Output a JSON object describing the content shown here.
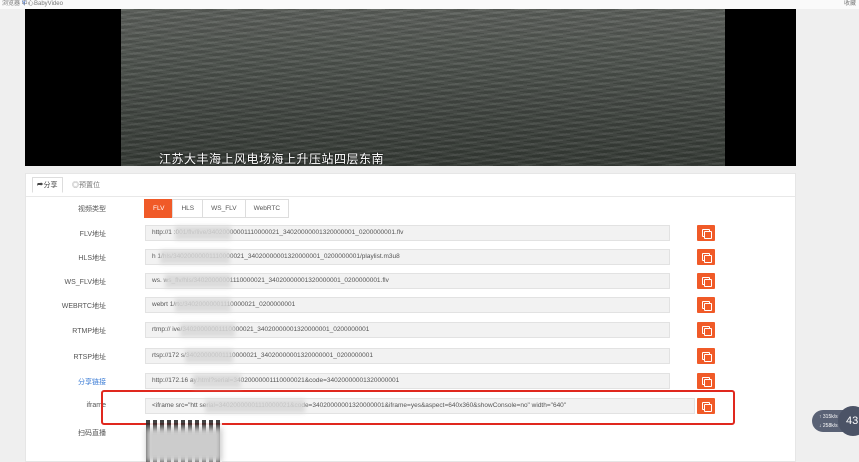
{
  "topbar": {
    "left1": "浏览器 中心",
    "left2": "Y",
    "left3": "BabyVideo",
    "right": "收藏"
  },
  "video": {
    "caption": "江苏大丰海上风电场海上升压站四层东南"
  },
  "tabs": [
    {
      "label": "⮫分享"
    },
    {
      "label": "◎预置位"
    }
  ],
  "form": {
    "video_type_label": "视频类型",
    "types": [
      "FLV",
      "HLS",
      "WS_FLV",
      "WebRTC"
    ],
    "selected_type": "FLV",
    "rows": [
      {
        "label": "FLV地址",
        "value": "http://1                         :001/flv/live/34020000001110000021_34020000001320000001_0200000001.flv"
      },
      {
        "label": "HLS地址",
        "value": "h                            1/hls/34020000001110000021_34020000001320000001_0200000001/playlist.m3u8"
      },
      {
        "label": "WS_FLV地址",
        "value": "ws.                          ws_flv/hls/34020000001110000021_34020000001320000001_0200000001.flv"
      },
      {
        "label": "WEBRTC地址",
        "value": "webrt                        1/rtc/34020000001110000021_0200000001"
      },
      {
        "label": "RTMP地址",
        "value": "rtmp://                      ive/34020000001110000021_34020000001320000001_0200000001"
      },
      {
        "label": "RTSP地址",
        "value": "rtsp://172                   s/34020000001110000021_34020000001320000001_0200000001"
      },
      {
        "label": "分享链接",
        "value": "http://172.16                ay.html?serial=34020000001110000021&code=34020000001320000001"
      },
      {
        "label": "iframe",
        "value": "<iframe src=\"htt                          serial=34020000001110000021&code=34020000001320000001&iframe=yes&aspect=640x360&showConsole=no\" width=\"640\""
      }
    ],
    "qr_label": "扫码直播"
  },
  "widget": {
    "line1": "↑ 315k/s",
    "line2": "↓ 258k/s",
    "badge": "43"
  }
}
